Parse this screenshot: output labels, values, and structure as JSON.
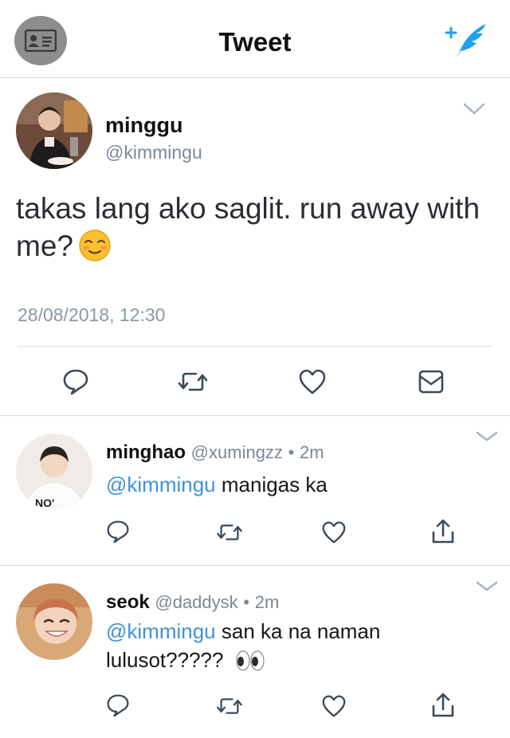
{
  "header": {
    "title": "Tweet"
  },
  "colors": {
    "accent": "#1da1f2",
    "mention": "#3e93d6",
    "meta": "#7c8893"
  },
  "tweet": {
    "name": "minggu",
    "handle": "@kimmingu",
    "text": "takas lang ako saglit. run away with me?",
    "emoji": "smiling-face-emoji",
    "timestamp": "28/08/2018, 12:30",
    "actions": [
      "reply-icon",
      "retweet-icon",
      "like-icon",
      "direct-message-icon"
    ]
  },
  "replies": [
    {
      "name": "minghao",
      "handle": "@xumingzz",
      "sep": "•",
      "time": "2m",
      "mention": "@kimmingu",
      "text": "manigas ka"
    },
    {
      "name": "seok",
      "handle": "@daddysk",
      "sep": "•",
      "time": "2m",
      "mention": "@kimmingu",
      "text": "san ka na naman lulusot?????",
      "emoji": "eyes-emoji"
    }
  ]
}
